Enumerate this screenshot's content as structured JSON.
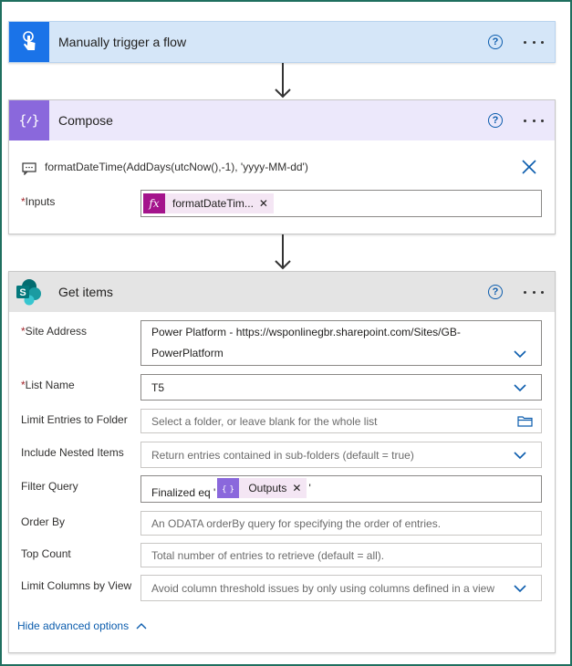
{
  "trigger": {
    "title": "Manually trigger a flow",
    "help": "?"
  },
  "compose": {
    "title": "Compose",
    "help": "?",
    "comment": "formatDateTime(AddDays(utcNow(),-1), 'yyyy-MM-dd')",
    "inputs_label": "Inputs",
    "inputs_token": "formatDateTim...",
    "token_icon": "fx"
  },
  "get_items": {
    "title": "Get items",
    "help": "?",
    "fields": {
      "site_address": {
        "label": "Site Address",
        "value_line1": "Power Platform - https://wsponlinegbr.sharepoint.com/Sites/GB-",
        "value_line2": "PowerPlatform"
      },
      "list_name": {
        "label": "List Name",
        "value": "T5"
      },
      "limit_folder": {
        "label": "Limit Entries to Folder",
        "placeholder": "Select a folder, or leave blank for the whole list"
      },
      "nested": {
        "label": "Include Nested Items",
        "placeholder": "Return entries contained in sub-folders (default = true)"
      },
      "filter": {
        "label": "Filter Query",
        "prefix": "Finalized eq '",
        "token": "Outputs",
        "suffix": "'"
      },
      "order_by": {
        "label": "Order By",
        "placeholder": "An ODATA orderBy query for specifying the order of entries."
      },
      "top_count": {
        "label": "Top Count",
        "placeholder": "Total number of entries to retrieve (default = all)."
      },
      "limit_columns": {
        "label": "Limit Columns by View",
        "placeholder": "Avoid column threshold issues by only using columns defined in a view"
      }
    },
    "advanced_toggle": "Hide advanced options",
    "required_marker": "*"
  },
  "colors": {
    "trigger_header_bg": "#d5e6f8",
    "trigger_icon_bg": "#1a73e8",
    "compose_header_bg": "#ece8fb",
    "compose_icon_bg": "#8a68dc",
    "sharepoint_header_bg": "#e4e4e4",
    "token_bg": "#f4e6f4",
    "fx_icon_bg": "#a4148c",
    "link": "#0b5cad"
  },
  "icons": {
    "trigger": "touch-hand-icon",
    "compose": "braces-icon",
    "sharepoint": "sharepoint-logo-icon"
  }
}
